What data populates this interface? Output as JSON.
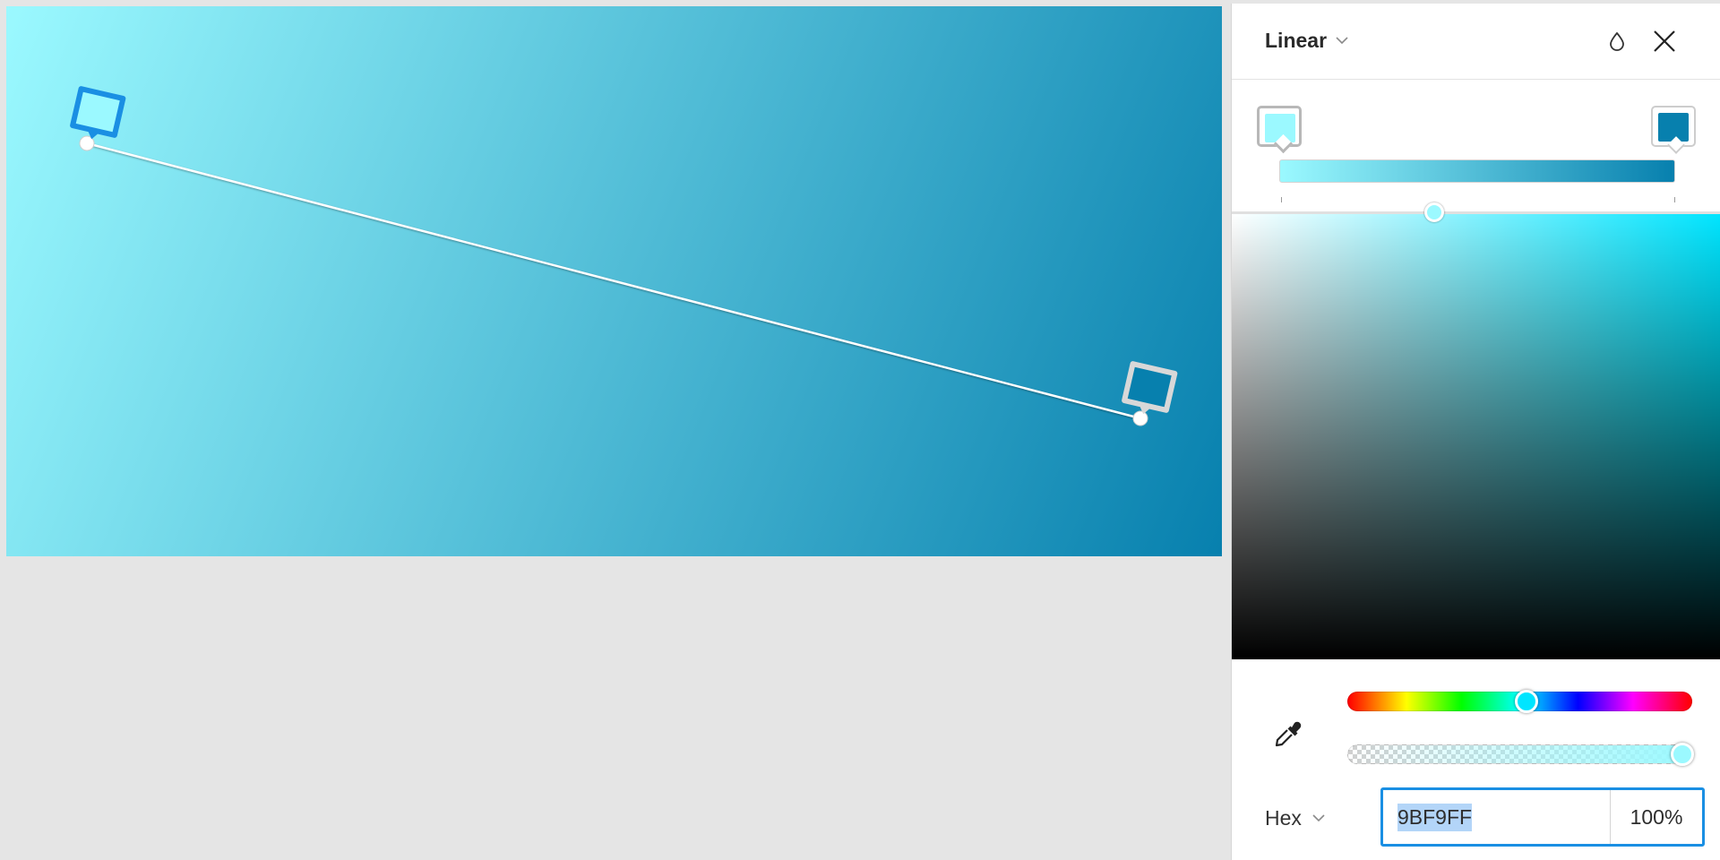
{
  "gradient": {
    "type_label": "Linear",
    "start_color": "#9BF9FF",
    "end_color": "#0780AE"
  },
  "header": {
    "type_dropdown_icon": "chevron-down-icon",
    "style_icon": "drop-icon",
    "close_icon": "close-icon"
  },
  "picker": {
    "base_hue_color": "#00E5FF",
    "eyedropper_icon": "eyedropper-icon",
    "hue_position": 0.52,
    "alpha_position": 1.0,
    "format_label": "Hex",
    "format_dropdown_icon": "chevron-down-icon",
    "hex_value": "9BF9FF",
    "alpha_value": "100%"
  },
  "colors": {
    "accent": "#1A8FE3",
    "panel_background": "#FFFFFF",
    "workspace_background": "#E5E5E5"
  }
}
